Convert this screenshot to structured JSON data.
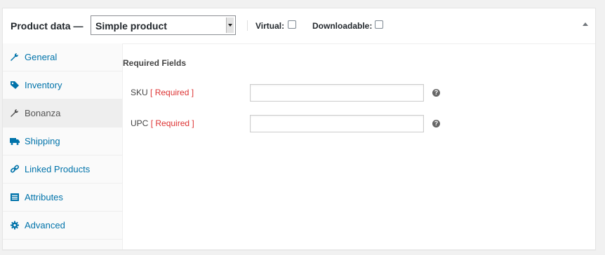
{
  "header": {
    "title": "Product data —",
    "product_type": "Simple product",
    "virtual_label": "Virtual:",
    "downloadable_label": "Downloadable:",
    "virtual_checked": false,
    "downloadable_checked": false
  },
  "tabs": [
    {
      "label": "General",
      "icon": "wrench-icon",
      "active": false
    },
    {
      "label": "Inventory",
      "icon": "tag-icon",
      "active": false
    },
    {
      "label": "Bonanza",
      "icon": "wrench-icon",
      "active": true
    },
    {
      "label": "Shipping",
      "icon": "truck-icon",
      "active": false
    },
    {
      "label": "Linked Products",
      "icon": "link-icon",
      "active": false
    },
    {
      "label": "Attributes",
      "icon": "list-icon",
      "active": false
    },
    {
      "label": "Advanced",
      "icon": "gear-icon",
      "active": false
    }
  ],
  "main": {
    "section_title": "Required Fields",
    "fields": [
      {
        "label": "SKU",
        "required": "[ Required ]",
        "value": ""
      },
      {
        "label": "UPC",
        "required": "[ Required ]",
        "value": ""
      }
    ]
  },
  "colors": {
    "link": "#0073aa",
    "required": "#dd3333",
    "active_tab": "#eeeeee"
  }
}
